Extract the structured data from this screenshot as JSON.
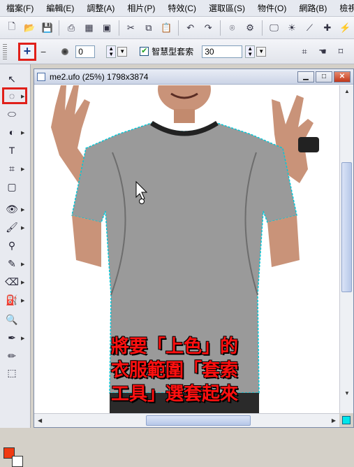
{
  "menubar": {
    "items": [
      "檔案(F)",
      "編輯(E)",
      "調整(A)",
      "相片(P)",
      "特效(C)",
      "選取區(S)",
      "物件(O)",
      "網路(B)",
      "檢視(V)"
    ]
  },
  "toolbar2": {
    "feather_value": "0",
    "smart_lasso_label": "智慧型套索",
    "smart_lasso_checked": true,
    "tolerance_value": "30"
  },
  "document": {
    "title": "me2.ufo (25%) 1798x3874"
  },
  "annotation": {
    "line1": "將要「上色」的",
    "line2": "衣服範圍「套索",
    "line3": "工具」選套起來"
  },
  "colors": {
    "foreground": "#f03a12",
    "background": "#ffffff",
    "highlight": "#e0201a",
    "selection": "#00c8d8",
    "shirt": "#9a9a9a"
  }
}
